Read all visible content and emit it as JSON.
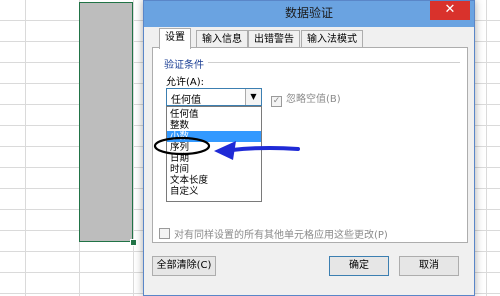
{
  "dialog": {
    "title": "数据验证",
    "close_icon": "close-icon"
  },
  "tabs": [
    {
      "label": "设置",
      "active": true
    },
    {
      "label": "输入信息",
      "active": false
    },
    {
      "label": "出错警告",
      "active": false
    },
    {
      "label": "输入法模式",
      "active": false
    }
  ],
  "settings": {
    "section_title": "验证条件",
    "allow_label": "允许(A):",
    "allow_value": "任何值",
    "ignore_blank_label": "忽略空值(B)",
    "ignore_blank_checked": true,
    "apply_all_label": "对有同样设置的所有其他单元格应用这些更改(P)"
  },
  "dropdown_options": [
    {
      "label": "任何值",
      "selected": false
    },
    {
      "label": "整数",
      "selected": false
    },
    {
      "label": "小数",
      "selected": true
    },
    {
      "label": "序列",
      "selected": false
    },
    {
      "label": "日期",
      "selected": false
    },
    {
      "label": "时间",
      "selected": false
    },
    {
      "label": "文本长度",
      "selected": false
    },
    {
      "label": "自定义",
      "selected": false
    }
  ],
  "buttons": {
    "clear_all": "全部清除(C)",
    "ok": "确定",
    "cancel": "取消"
  },
  "colors": {
    "annotation": "#1f2ad6",
    "selection": "#3399ff",
    "titlebar": "#6aa3e1",
    "close": "#d9322c"
  }
}
